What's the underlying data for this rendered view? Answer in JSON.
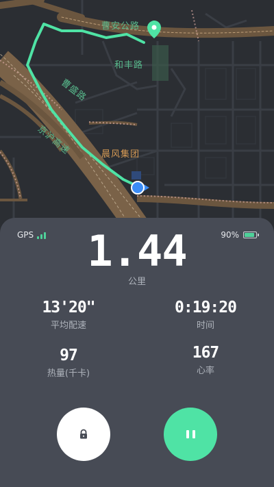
{
  "map": {
    "labels": {
      "road_top": "曹安公路",
      "road_hefeng": "和丰路",
      "road_caosheng": "曹盛路",
      "highway": "京沪高速",
      "poi": "晨风集团"
    },
    "colors": {
      "background": "#2b2e33",
      "route": "#4fe3a5",
      "highway": "#7a6248",
      "road": "#3c4047",
      "position_dot": "#3b8cf5"
    }
  },
  "status": {
    "gps_label": "GPS",
    "signal_level": 3,
    "battery_text": "90%",
    "battery_level": 0.9
  },
  "run": {
    "distance": "1.44",
    "distance_unit": "公里",
    "pace_value": "13'20\"",
    "pace_label": "平均配速",
    "time_value": "0:19:20",
    "time_label": "时间",
    "calories_value": "97",
    "calories_label": "热量(千卡)",
    "heart_rate_value": "167",
    "heart_rate_label": "心率"
  },
  "controls": {
    "lock_icon": "lock-icon",
    "pause_icon": "pause-icon"
  }
}
